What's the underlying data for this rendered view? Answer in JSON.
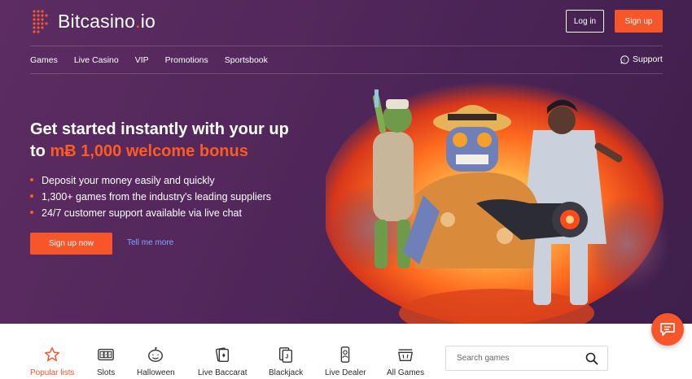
{
  "header": {
    "logo_text_main": "Bitcasino",
    "logo_text_dot": ".",
    "logo_text_tld": "io",
    "login_label": "Log in",
    "signup_label": "Sign up"
  },
  "nav": {
    "items": [
      "Games",
      "Live Casino",
      "VIP",
      "Promotions",
      "Sportsbook"
    ],
    "support_label": "Support"
  },
  "hero": {
    "headline_line1": "Get started instantly with your up",
    "headline_prefix": "to ",
    "headline_bonus": "mɃ 1,000 welcome bonus",
    "bullets": [
      "Deposit your money easily and quickly",
      "1,300+ games from the industry's leading suppliers",
      "24/7 customer support available via live chat"
    ],
    "cta_label": "Sign up now",
    "more_label": "Tell me more"
  },
  "categories": {
    "items": [
      {
        "label": "Popular lists",
        "icon": "star-icon"
      },
      {
        "label": "Slots",
        "icon": "slot-machine-icon"
      },
      {
        "label": "Halloween",
        "icon": "pumpkin-icon"
      },
      {
        "label": "Live Baccarat",
        "icon": "cards-icon"
      },
      {
        "label": "Blackjack",
        "icon": "card-icon"
      },
      {
        "label": "Live Dealer",
        "icon": "dealer-phone-icon"
      },
      {
        "label": "All Games",
        "icon": "basket-icon"
      }
    ],
    "search_placeholder": "Search games"
  },
  "colors": {
    "accent": "#f7562b",
    "hero_bg": "#54285c",
    "link": "#7fa8ff"
  }
}
